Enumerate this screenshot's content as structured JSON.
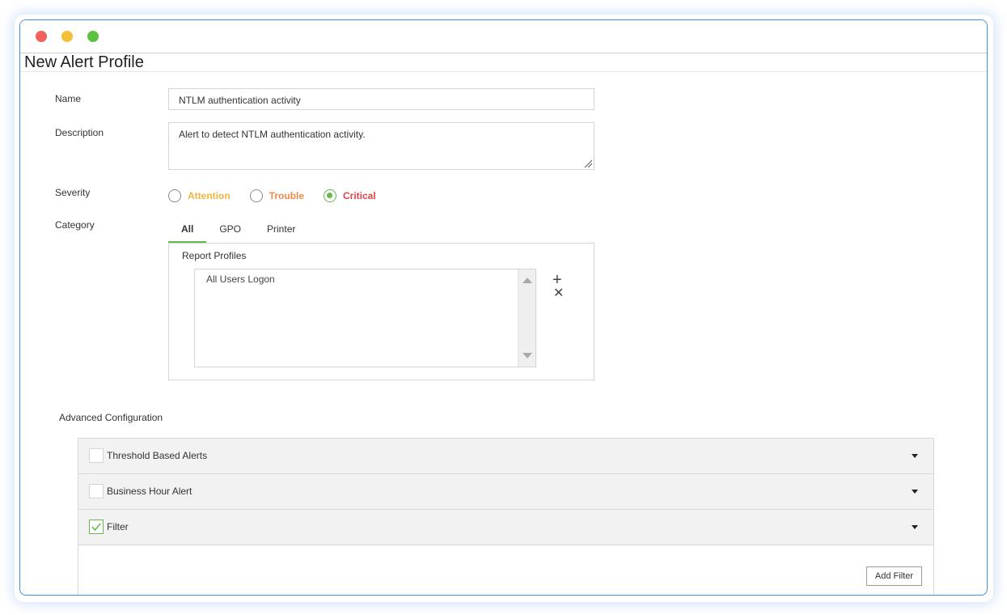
{
  "window": {
    "title": "New Alert Profile",
    "controls": [
      "close",
      "minimize",
      "maximize"
    ]
  },
  "form": {
    "name_label": "Name",
    "name_value": "NTLM authentication activity",
    "description_label": "Description",
    "description_value": "Alert to detect NTLM authentication activity.",
    "severity_label": "Severity",
    "severity_options": [
      {
        "label": "Attention",
        "color": "#f2b43c",
        "selected": false
      },
      {
        "label": "Trouble",
        "color": "#f08a4b",
        "selected": false
      },
      {
        "label": "Critical",
        "color": "#e0454a",
        "selected": true
      }
    ],
    "category_label": "Category",
    "category_tabs": [
      {
        "label": "All",
        "active": true
      },
      {
        "label": "GPO",
        "active": false
      },
      {
        "label": "Printer",
        "active": false
      }
    ],
    "report_profiles_label": "Report Profiles",
    "report_profiles": [
      "All Users Logon"
    ]
  },
  "advanced": {
    "title": "Advanced Configuration",
    "sections": [
      {
        "label": "Threshold Based Alerts",
        "checked": false
      },
      {
        "label": "Business Hour Alert",
        "checked": false
      },
      {
        "label": "Filter",
        "checked": true
      }
    ],
    "add_filter_label": "Add Filter"
  },
  "colors": {
    "window_border": "#3f8fdf",
    "accent_green": "#66b84f"
  }
}
